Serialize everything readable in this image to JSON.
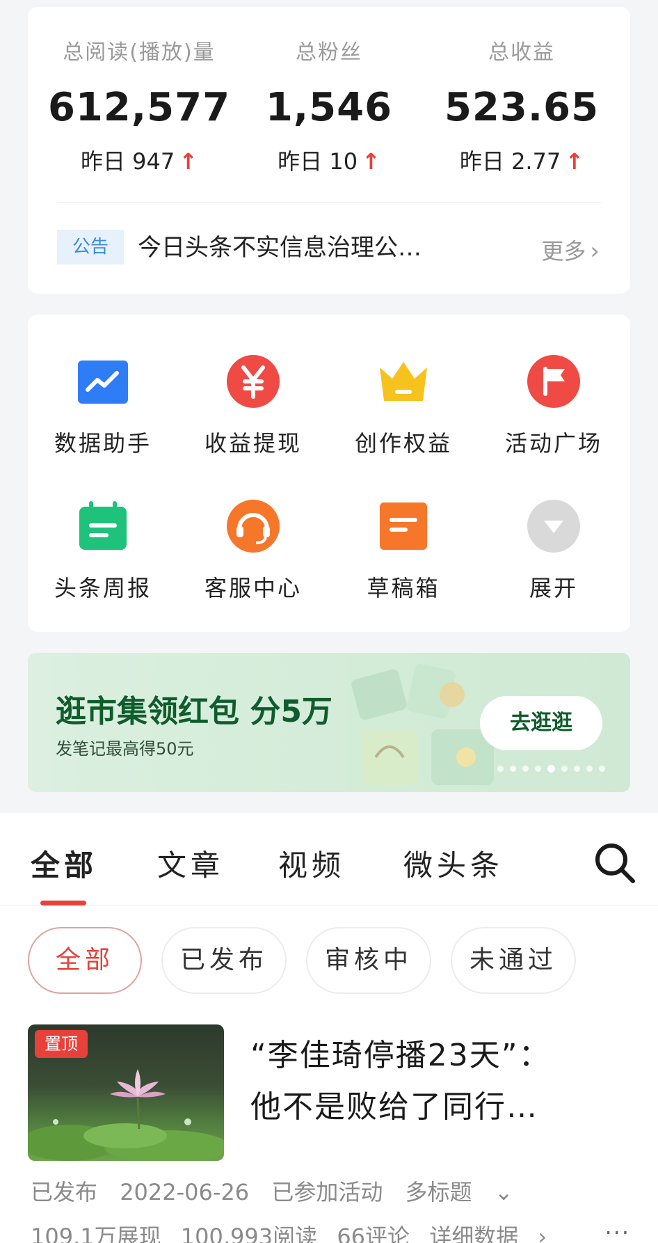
{
  "stats": {
    "items": [
      {
        "label": "总阅读(播放)量",
        "value": "612,577",
        "yesterday_label": "昨日",
        "yesterday_value": "947",
        "trend": "↑"
      },
      {
        "label": "总粉丝",
        "value": "1,546",
        "yesterday_label": "昨日",
        "yesterday_value": "10",
        "trend": "↑"
      },
      {
        "label": "总收益",
        "value": "523.65",
        "yesterday_label": "昨日",
        "yesterday_value": "2.77",
        "trend": "↑"
      }
    ],
    "notice": {
      "tag": "公告",
      "text": "今日头条不实信息治理公…",
      "more": "更多",
      "chevron": "›"
    }
  },
  "tools": [
    {
      "label": "数据助手",
      "icon": "chart-trend-icon",
      "color": "#2f7df5"
    },
    {
      "label": "收益提现",
      "icon": "yuan-icon",
      "color": "#f04a45"
    },
    {
      "label": "创作权益",
      "icon": "crown-icon",
      "color": "#f6c21d"
    },
    {
      "label": "活动广场",
      "icon": "flag-icon",
      "color": "#f04a45"
    },
    {
      "label": "头条周报",
      "icon": "calendar-icon",
      "color": "#1fc27b"
    },
    {
      "label": "客服中心",
      "icon": "headset-icon",
      "color": "#f6762a"
    },
    {
      "label": "草稿箱",
      "icon": "draft-icon",
      "color": "#f6762a"
    },
    {
      "label": "展开",
      "icon": "expand-icon",
      "color": "#d9d9d9"
    }
  ],
  "banner": {
    "title": "逛市集领红包 分5万",
    "subtitle": "发笔记最高得50元",
    "button": "去逛逛",
    "dot_count": 9,
    "active_dot": 4
  },
  "tabs": [
    "全部",
    "文章",
    "视频",
    "微头条"
  ],
  "filters": [
    "全部",
    "已发布",
    "审核中",
    "未通过"
  ],
  "article": {
    "pin": "置顶",
    "title_line1": "“李佳琦停播23天”：",
    "title_line2": "他不是败给了同行…",
    "status": "已发布",
    "date": "2022-06-26",
    "activity": "已参加活动",
    "multi_title": "多标题",
    "impressions": "109.1万展现",
    "reads": "100,993阅读",
    "comments": "66评论",
    "detail": "详细数据",
    "more": "···"
  },
  "colors": {
    "accent": "#e8403a",
    "banner_text": "#0f5c2c"
  }
}
